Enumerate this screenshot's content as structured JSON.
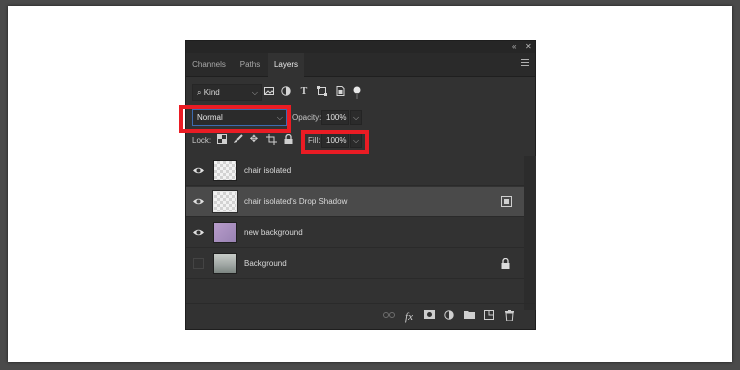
{
  "panel": {
    "collapse_glyph": "«",
    "close_glyph": "✕",
    "tabs": [
      {
        "label": "Channels"
      },
      {
        "label": "Paths"
      },
      {
        "label": "Layers"
      }
    ]
  },
  "filter": {
    "kind_label": "Kind",
    "search_glyph": "⌕",
    "chevron": "⌵",
    "icons": [
      "image-filter-icon",
      "adjustment-filter-icon",
      "type-filter-icon",
      "shape-filter-icon",
      "smart-object-filter-icon",
      "filter-toggle-icon"
    ]
  },
  "blend": {
    "mode": "Normal",
    "opacity_label": "Opacity:",
    "opacity_value": "100%",
    "chevron": "⌵"
  },
  "lock": {
    "label": "Lock:",
    "icons": [
      "lock-transparent-pixels-icon",
      "lock-image-pixels-icon",
      "lock-position-icon",
      "lock-artboard-icon",
      "lock-all-icon"
    ],
    "fill_label": "Fill:",
    "fill_value": "100%"
  },
  "layers": [
    {
      "name": "chair isolated",
      "visible": true,
      "thumb": "checker",
      "selected": false
    },
    {
      "name": "chair isolated's Drop Shadow",
      "visible": true,
      "thumb": "checker",
      "selected": true,
      "badge": "smart-object-badge-icon"
    },
    {
      "name": "new background",
      "visible": true,
      "thumb": "purple",
      "selected": false
    },
    {
      "name": "Background",
      "visible": false,
      "thumb": "photo",
      "selected": false,
      "badge": "lock-icon"
    }
  ],
  "bottom_icons": [
    "link-layers-icon",
    "fx-icon",
    "add-mask-icon",
    "adjustment-layer-icon",
    "new-group-icon",
    "new-layer-icon",
    "delete-layer-icon"
  ],
  "fx_label": "fx",
  "highlight_color": "#ea1c24"
}
